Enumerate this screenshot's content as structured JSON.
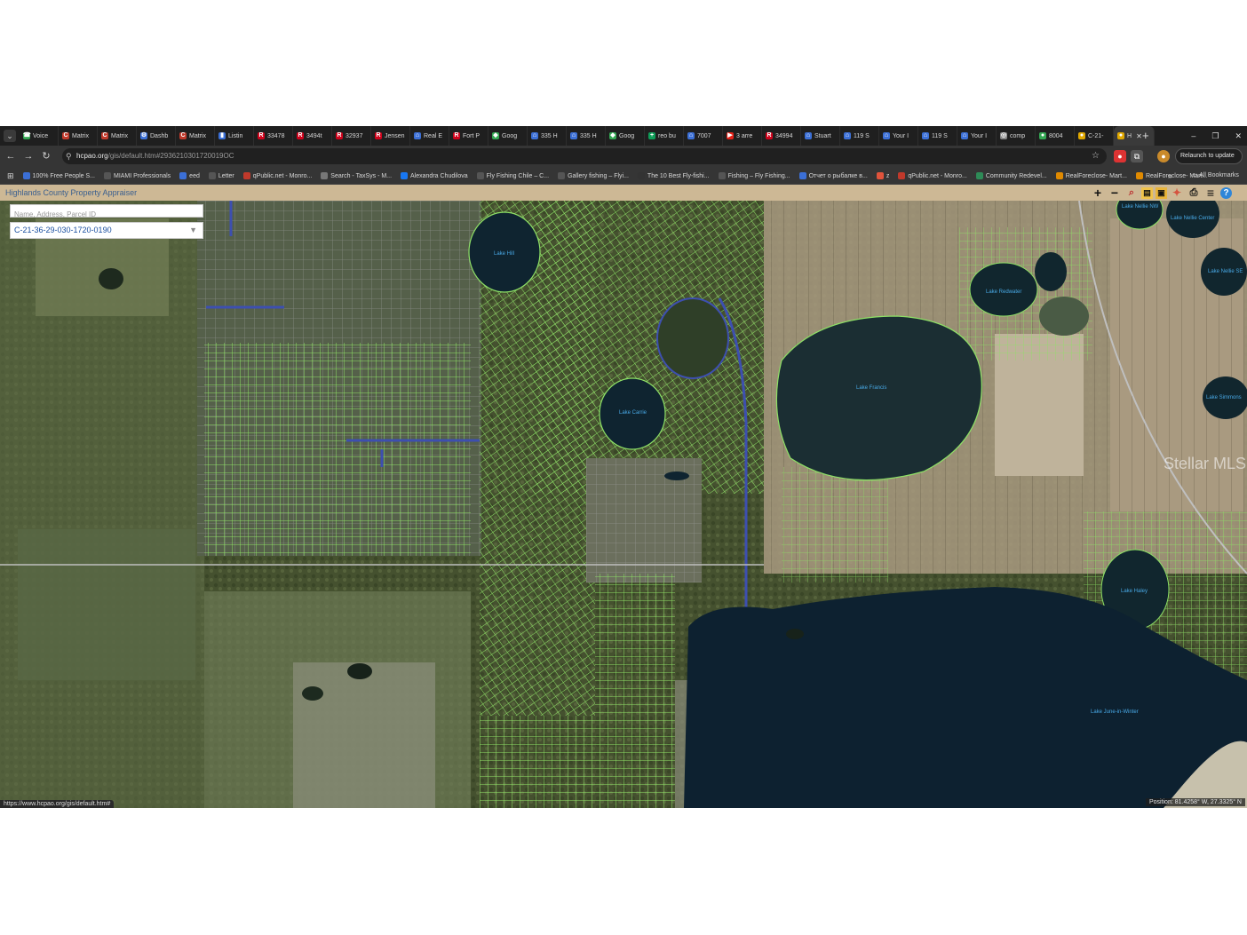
{
  "browser": {
    "tabs": [
      {
        "label": "Voice",
        "color": "#34a853",
        "glyph": "☎"
      },
      {
        "label": "Matrix",
        "color": "#c0392b",
        "glyph": "C"
      },
      {
        "label": "Matrix",
        "color": "#c0392b",
        "glyph": "C"
      },
      {
        "label": "Dashb",
        "color": "#3b6fd6",
        "glyph": "⚙"
      },
      {
        "label": "Matrix",
        "color": "#c0392b",
        "glyph": "C"
      },
      {
        "label": "Listin",
        "color": "#3b6fd6",
        "glyph": "▮"
      },
      {
        "label": "33478",
        "color": "#d0021b",
        "glyph": "R"
      },
      {
        "label": "3494t",
        "color": "#d0021b",
        "glyph": "R"
      },
      {
        "label": "32937",
        "color": "#d0021b",
        "glyph": "R"
      },
      {
        "label": "Jensen",
        "color": "#d0021b",
        "glyph": "R"
      },
      {
        "label": "Real E",
        "color": "#3b6fd6",
        "glyph": "⌂"
      },
      {
        "label": "Fort P",
        "color": "#d0021b",
        "glyph": "R"
      },
      {
        "label": "Goog",
        "color": "#34a853",
        "glyph": "◆"
      },
      {
        "label": "335 H",
        "color": "#3b6fd6",
        "glyph": "⌂"
      },
      {
        "label": "335 H",
        "color": "#3b6fd6",
        "glyph": "⌂"
      },
      {
        "label": "Goog",
        "color": "#34a853",
        "glyph": "◆"
      },
      {
        "label": "reo bu",
        "color": "#0f9d58",
        "glyph": "+"
      },
      {
        "label": "7007",
        "color": "#3b6fd6",
        "glyph": "⌂"
      },
      {
        "label": "3 arre",
        "color": "#e62117",
        "glyph": "▶"
      },
      {
        "label": "34994",
        "color": "#d0021b",
        "glyph": "R"
      },
      {
        "label": "Stuart",
        "color": "#3b6fd6",
        "glyph": "⌂"
      },
      {
        "label": "119 S",
        "color": "#3b6fd6",
        "glyph": "⌂"
      },
      {
        "label": "Your I",
        "color": "#3b6fd6",
        "glyph": "⌂"
      },
      {
        "label": "119 S",
        "color": "#3b6fd6",
        "glyph": "⌂"
      },
      {
        "label": "Your I",
        "color": "#3b6fd6",
        "glyph": "⌂"
      },
      {
        "label": "comp",
        "color": "#888888",
        "glyph": "◎"
      },
      {
        "label": "8004",
        "color": "#34a853",
        "glyph": "●"
      },
      {
        "label": "C-21-",
        "color": "#e0a800",
        "glyph": "●"
      },
      {
        "label": "H",
        "color": "#e0a800",
        "glyph": "●",
        "active": true
      }
    ],
    "new_tab": "+",
    "window_controls": [
      "–",
      "❐",
      "✕"
    ],
    "url_host": "hcpao.org",
    "url_path": "/gis/default.htm#2936210301720019OC",
    "relaunch_label": "Relaunch to update",
    "bookmarks": [
      {
        "label": "100% Free People S...",
        "color": "#3b6fd6"
      },
      {
        "label": "MIAMI Professionals",
        "color": "#555555"
      },
      {
        "label": "eed",
        "color": "#3b6fd6"
      },
      {
        "label": "Letter",
        "color": "#555555"
      },
      {
        "label": "qPublic.net - Monro...",
        "color": "#c0392b"
      },
      {
        "label": "Search - TaxSys - M...",
        "color": "#777777"
      },
      {
        "label": "Alexandra Chudilova",
        "color": "#1877f2"
      },
      {
        "label": "Fly Fishing Chile – C...",
        "color": "#555555"
      },
      {
        "label": "Gallery fishing – Flyi...",
        "color": "#555555"
      },
      {
        "label": "The 10 Best Fly-fishi...",
        "color": "#333333"
      },
      {
        "label": "Fishing – Fly Fishing...",
        "color": "#555555"
      },
      {
        "label": "Отчет о рыбалке в...",
        "color": "#3b6fd6"
      },
      {
        "label": "z",
        "color": "#e0533b"
      },
      {
        "label": "qPublic.net - Monro...",
        "color": "#c0392b"
      },
      {
        "label": "Community Redevel...",
        "color": "#2e8b57"
      },
      {
        "label": "RealForeclose- Mart...",
        "color": "#e08a00"
      },
      {
        "label": "RealForeclose- Mart...",
        "color": "#e08a00"
      }
    ],
    "bookmarks_more": "»",
    "all_bookmarks": "All Bookmarks",
    "status_url": "https://www.hcpao.org/gis/default.htm#"
  },
  "app": {
    "title": "Highlands County Property Appraiser",
    "search_placeholder": "Name, Address, Parcel ID",
    "parcel_id": "C-21-36-29-030-1720-0190",
    "position": "Position: 81.4258° W, 27.3325° N",
    "watermark": "Stellar MLS"
  },
  "lakes": [
    "Lake Hill",
    "Lake Carrie",
    "Lake Francis",
    "Lake Redwater",
    "Lake Nellie NW",
    "Lake Nellie Center",
    "Lake Nellie SE",
    "Lake Simmons",
    "Lake Haley",
    "Lake June-in-Winter"
  ],
  "colors": {
    "parcel_line": "#7ed957",
    "header_bar": "#cdb895",
    "lake_label": "#48a9e6"
  }
}
